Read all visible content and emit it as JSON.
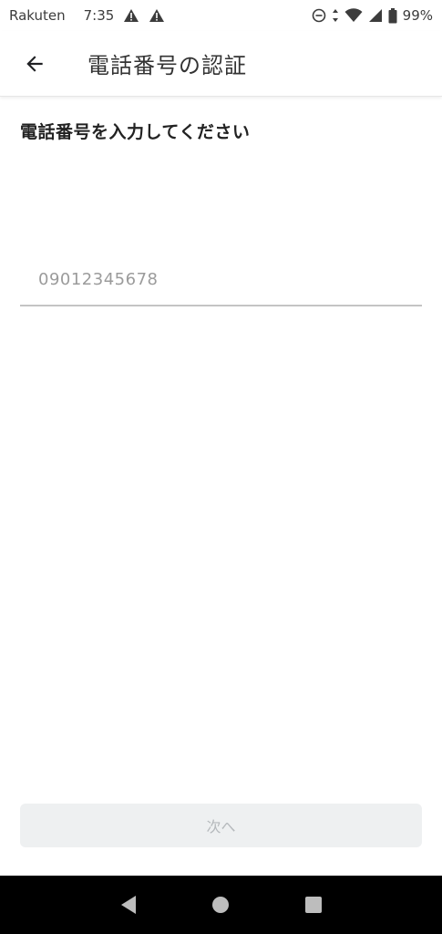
{
  "status_bar": {
    "carrier": "Rakuten",
    "time": "7:35",
    "battery": "99%",
    "icons": [
      "warning-icon",
      "warning-icon",
      "dnd-icon",
      "data-arrows-icon",
      "wifi-icon",
      "signal-icon",
      "battery-icon"
    ]
  },
  "app_bar": {
    "title": "電話番号の認証",
    "back_icon": "arrow-back-icon"
  },
  "content": {
    "instruction": "電話番号を入力してください",
    "phone_placeholder": "09012345678",
    "phone_value": ""
  },
  "next_button": {
    "label": "次へ",
    "enabled": false
  },
  "nav_bar": {
    "icons": [
      "back-triangle-icon",
      "home-circle-icon",
      "recents-square-icon"
    ]
  },
  "colors": {
    "accent": "#202124",
    "divider": "#c4c4c4",
    "disabled_button_bg": "#eef0f1",
    "disabled_button_text": "#b5b9bc",
    "nav_bar_bg": "#000000"
  }
}
